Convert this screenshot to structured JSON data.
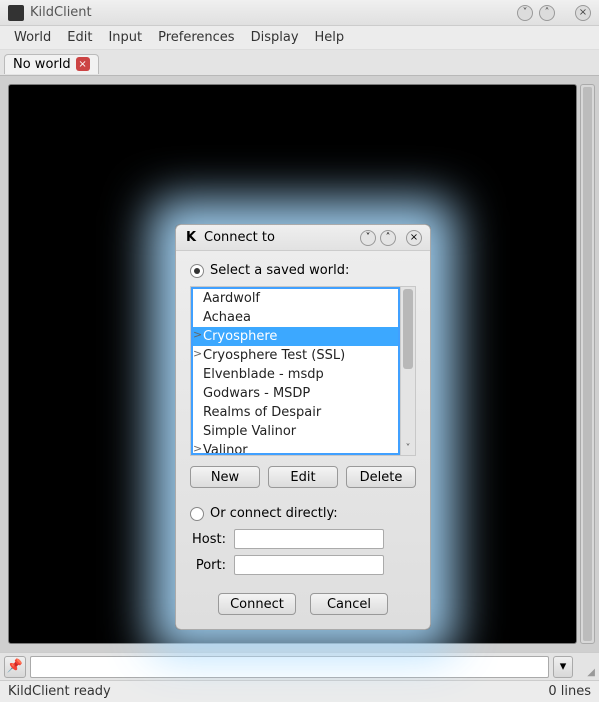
{
  "window": {
    "title": "KildClient"
  },
  "menubar": {
    "items": [
      "World",
      "Edit",
      "Input",
      "Preferences",
      "Display",
      "Help"
    ]
  },
  "tabs": [
    {
      "label": "No world"
    }
  ],
  "dialog": {
    "title": "Connect to",
    "radio_saved": "Select a saved world:",
    "radio_direct": "Or connect directly:",
    "buttons": {
      "new": "New",
      "edit": "Edit",
      "delete": "Delete",
      "connect": "Connect",
      "cancel": "Cancel"
    },
    "host_label": "Host:",
    "port_label": "Port:",
    "host_value": "",
    "port_value": "",
    "worlds": [
      {
        "name": "Aardwolf",
        "selected": false,
        "expander": ""
      },
      {
        "name": "Achaea",
        "selected": false,
        "expander": ""
      },
      {
        "name": "Cryosphere",
        "selected": true,
        "expander": ">"
      },
      {
        "name": "Cryosphere Test (SSL)",
        "selected": false,
        "expander": ">"
      },
      {
        "name": "Elvenblade - msdp",
        "selected": false,
        "expander": ""
      },
      {
        "name": "Godwars - MSDP",
        "selected": false,
        "expander": ""
      },
      {
        "name": "Realms of Despair",
        "selected": false,
        "expander": ""
      },
      {
        "name": "Simple Valinor",
        "selected": false,
        "expander": ""
      },
      {
        "name": "Valinor",
        "selected": false,
        "expander": ">"
      }
    ]
  },
  "status": {
    "message": "KildClient ready",
    "lines": "0 lines"
  }
}
